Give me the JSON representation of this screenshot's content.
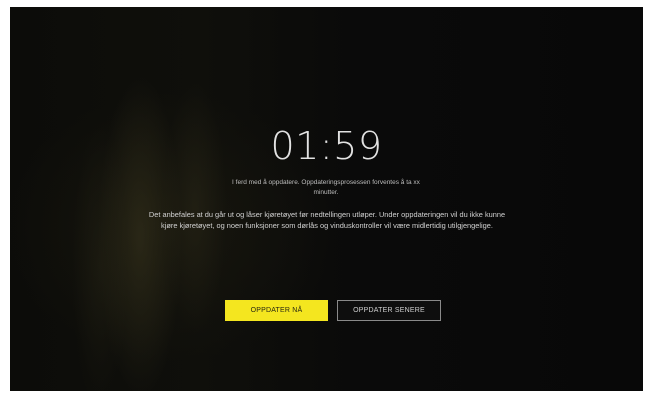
{
  "countdown": {
    "time": "01:59"
  },
  "message": {
    "subtitle": "I ferd med å oppdatere. Oppdateringsprosessen forventes å ta xx minutter.",
    "details": "Det anbefales at du går ut og låser kjøretøyet før nedtellingen utløper. Under oppdateringen vil du ikke kunne kjøre kjøretøyet, og noen funksjoner som dørlås og vinduskontroller vil være midlertidig utilgjengelige."
  },
  "actions": {
    "update_now_label": "OPPDATER NÅ",
    "update_later_label": "OPPDATER SENERE"
  },
  "colors": {
    "accent": "#f4e61f",
    "background": "#0a0a0a"
  }
}
